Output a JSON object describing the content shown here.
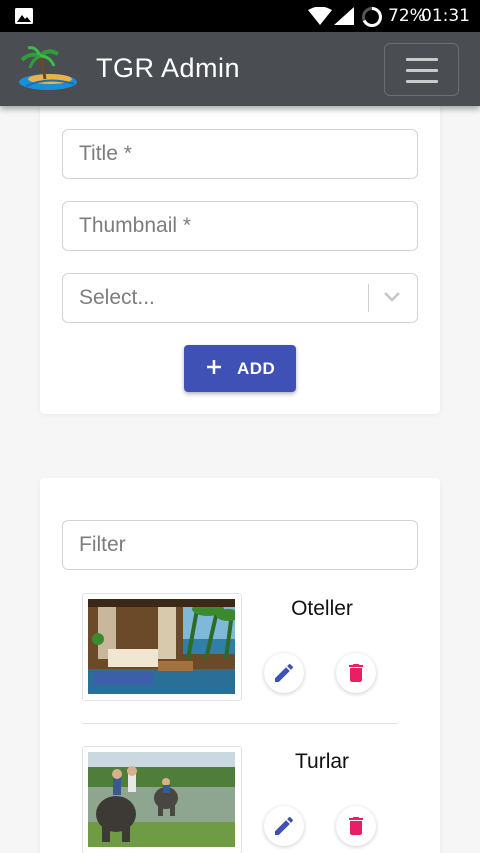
{
  "status_bar": {
    "battery": "72%",
    "time": "01:31"
  },
  "app_bar": {
    "title": "TGR Admin"
  },
  "form": {
    "title_placeholder": "Title *",
    "thumbnail_placeholder": "Thumbnail *",
    "select_placeholder": "Select...",
    "add_label": "ADD"
  },
  "list": {
    "filter_placeholder": "Filter",
    "items": [
      {
        "title": "Oteller"
      },
      {
        "title": "Turlar"
      }
    ]
  },
  "colors": {
    "primary": "#3f51b5",
    "delete": "#e91e63",
    "app_bar": "#4a4d52"
  }
}
